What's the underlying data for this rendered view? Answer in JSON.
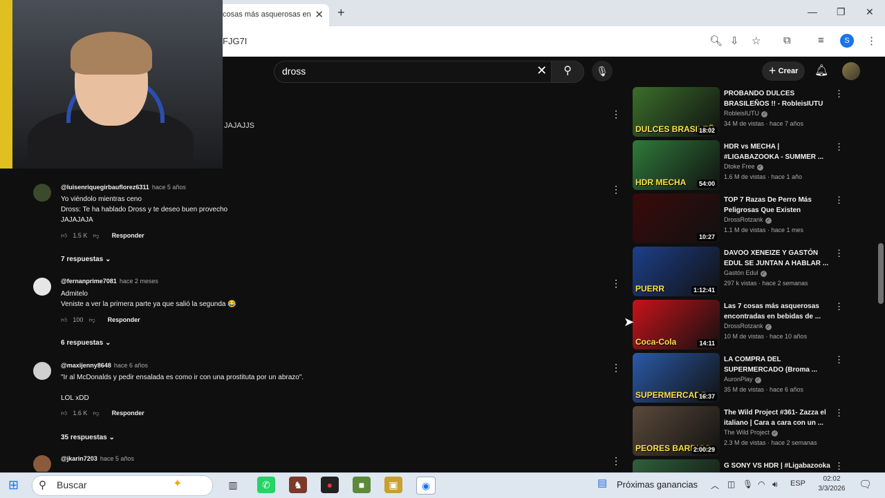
{
  "browser": {
    "tab_title": "cosas más asquerosas en",
    "url_fragment": "FJG7I",
    "profile_initial": "S"
  },
  "youtube": {
    "search_query": "dross",
    "create_label": "Crear"
  },
  "partial_comment_text": "JAJAJJS",
  "comments": [
    {
      "author": "@luisenriquegirbauflorez6311",
      "date": "hace 5 años",
      "lines": [
        "Yo viéndolo mientras ceno",
        "Dross: Te ha hablado Dross y te deseo buen provecho",
        "JAJAJAJA"
      ],
      "likes": "1.5 K",
      "reply_label": "Responder",
      "replies": "7 respuestas"
    },
    {
      "author": "@fernanprime7081",
      "date": "hace 2 meses",
      "lines": [
        "Admitelo",
        "Veniste a ver la primera parte ya que salió la segunda 😂"
      ],
      "likes": "100",
      "reply_label": "Responder",
      "replies": "6 respuestas"
    },
    {
      "author": "@maxijenny8648",
      "date": "hace 6 años",
      "lines": [
        "\"Ir al McDonalds y pedir ensalada es como ir con una prostituta por un abrazo\".",
        "",
        "LOL xDD"
      ],
      "likes": "1.6 K",
      "reply_label": "Responder",
      "replies": "35 respuestas"
    },
    {
      "author": "@jkarin7203",
      "date": "hace 5 años",
      "lines": [],
      "likes": "",
      "reply_label": "",
      "replies": ""
    }
  ],
  "related_videos": [
    {
      "title": "PROBANDO DULCES BRASILEÑOS !! - RobleisIUTU",
      "channel": "RobleisIUTU",
      "meta": "34 M de vistas · hace 7 años",
      "duration": "18:02",
      "thumb_text": "DULCES BRASILEÑ",
      "thumb_color": "#3b6f2a"
    },
    {
      "title": "HDR vs MECHA | #LIGABAZOOKA - SUMMER ...",
      "channel": "Dtoke Free",
      "meta": "1.6 M de vistas · hace 1 año",
      "duration": "54:00",
      "thumb_text": "HDR  MECHA",
      "thumb_color": "#2f7a3a"
    },
    {
      "title": "TOP 7 Razas De Perro Más Peligrosas Que Existen",
      "channel": "DrossRotzank",
      "meta": "1.1 M de vistas · hace 1 mes",
      "duration": "10:27",
      "thumb_text": "",
      "thumb_color": "#3a0a0a"
    },
    {
      "title": "DAVOO XENEIZE Y GASTÓN EDUL SE JUNTAN A HABLAR ...",
      "channel": "Gastón Edul",
      "meta": "297 k vistas · hace 2 semanas",
      "duration": "1:12:41",
      "thumb_text": "PUERR",
      "thumb_color": "#1d3f8a"
    },
    {
      "title": "Las 7 cosas más asquerosas encontradas en bebidas de ...",
      "channel": "DrossRotzank",
      "meta": "10 M de vistas · hace 10 años",
      "duration": "14:11",
      "thumb_text": "Coca-Cola",
      "thumb_color": "#c8121a"
    },
    {
      "title": "LA COMPRA DEL SUPERMERCADO (Broma ...",
      "channel": "AuronPlay",
      "meta": "35 M de vistas · hace 6 años",
      "duration": "16:37",
      "thumb_text": "SUPERMERCADO",
      "thumb_color": "#2a5aa8"
    },
    {
      "title": "The Wild Project #361- Zazza el italiano | Cara a cara con un ...",
      "channel": "The Wild Project",
      "meta": "2.3 M de vistas · hace 2 semanas",
      "duration": "2:00:29",
      "thumb_text": "PEORES BARRIOS",
      "thumb_color": "#5a4a3a"
    },
    {
      "title": "G SONY VS HDR | #Ligabazooka",
      "channel": "",
      "meta": "",
      "duration": "",
      "thumb_text": "",
      "thumb_color": "#2f5f3a"
    }
  ],
  "taskbar": {
    "search_placeholder": "Buscar",
    "weather_text": "Próximas ganancias",
    "language": "ESP",
    "time": "02:02",
    "date": "3/3/2026"
  }
}
